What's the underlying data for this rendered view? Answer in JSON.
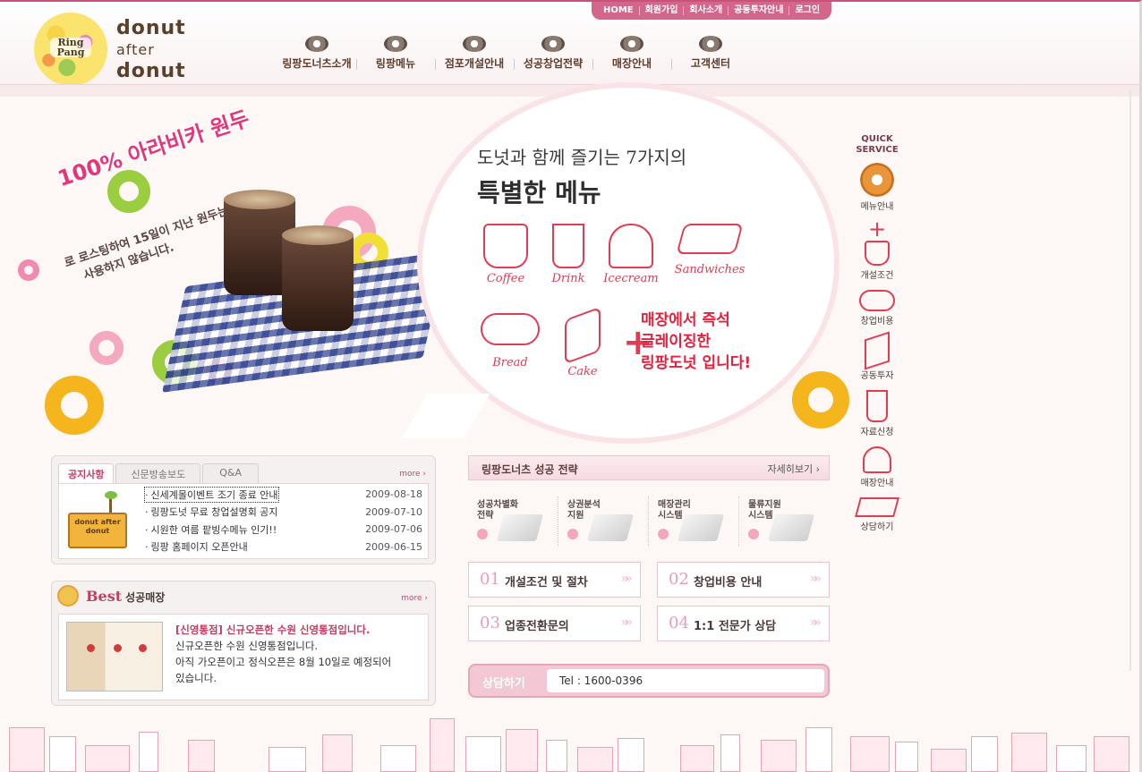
{
  "header": {
    "logo": {
      "ring_pang": "Ring Pang",
      "line1": "donut",
      "line2": "after",
      "line3": "donut"
    },
    "top_menu": [
      "HOME",
      "회원가입",
      "회사소개",
      "공동투자안내",
      "로그인"
    ],
    "gnb": [
      "링팡도너츠소개",
      "링팡메뉴",
      "점포개설안내",
      "성공창업전략",
      "매장안내",
      "고객센터"
    ]
  },
  "hero": {
    "coffee_headline": "100% 아라비카 원두",
    "coffee_sub1": "로 로스팅하여 15일이 지난 원두는",
    "coffee_sub2": "사용하지 않습니다.",
    "bubble_line1": "도넛과 함께 즐기는 7가지의",
    "bubble_line2": "특별한 메뉴",
    "menu_items": [
      "Coffee",
      "Drink",
      "Icecream",
      "Sandwiches",
      "Bread",
      "Cake"
    ],
    "note_line1": "매장에서 즉석",
    "note_line2": "글레이징한",
    "note_line3": "링팡도넛 입니다!",
    "colors": {
      "accent": "#e03c52",
      "pink": "#e7357a"
    }
  },
  "quick": {
    "title_line1": "QUICK",
    "title_line2": "SERVICE",
    "items": [
      {
        "label": "메뉴안내",
        "icon": "donut-icon"
      },
      {
        "label": "개설조건",
        "icon": "coffee-cup-icon"
      },
      {
        "label": "창업비용",
        "icon": "croissant-icon"
      },
      {
        "label": "공동투자",
        "icon": "cake-icon"
      },
      {
        "label": "자료신청",
        "icon": "drink-icon"
      },
      {
        "label": "매장안내",
        "icon": "icecream-icon"
      },
      {
        "label": "상담하기",
        "icon": "sandwich-icon"
      }
    ]
  },
  "notice": {
    "tabs": [
      "공지사항",
      "신문방송보도",
      "Q&A"
    ],
    "more": "more ›",
    "thumb_text": "donut after donut",
    "rows": [
      {
        "title": "신세계몰이벤트 조기 종료 안내",
        "date": "2009-08-18"
      },
      {
        "title": "링팡도넛 무료 창업설명회 공지",
        "date": "2009-07-10"
      },
      {
        "title": "시원한 여름 팥빙수메뉴 인기!!",
        "date": "2009-07-06"
      },
      {
        "title": "링팡 홈페이지 오픈안내",
        "date": "2009-06-15"
      }
    ]
  },
  "best": {
    "title": "Best",
    "subtitle": "성공매장",
    "more": "more ›",
    "headline": "[신영통점] 신규오픈한 수원 신영통점입니다.",
    "line1": "신규오픈한 수원 신영통점입니다.",
    "line2": "아직 가오픈이고 정식오픈은 8월 10일로 예정되어",
    "line3": "있습니다."
  },
  "strategy": {
    "title": "링팡도너츠 성공 전략",
    "more": "자세히보기 ›",
    "items": [
      {
        "l1": "성공차별화",
        "l2": "전략"
      },
      {
        "l1": "상권분석",
        "l2": "지원"
      },
      {
        "l1": "매장관리",
        "l2": "시스템"
      },
      {
        "l1": "물류지원",
        "l2": "시스템"
      }
    ],
    "steps": [
      {
        "num": "01",
        "label": "개설조건 및 절차"
      },
      {
        "num": "02",
        "label": "창업비용 안내"
      },
      {
        "num": "03",
        "label": "업종전환문의"
      },
      {
        "num": "04",
        "label": "1:1 전문가 상담"
      }
    ],
    "arrow": "»»"
  },
  "consult": {
    "label": "상담하기",
    "tel": "Tel : 1600-0396"
  }
}
